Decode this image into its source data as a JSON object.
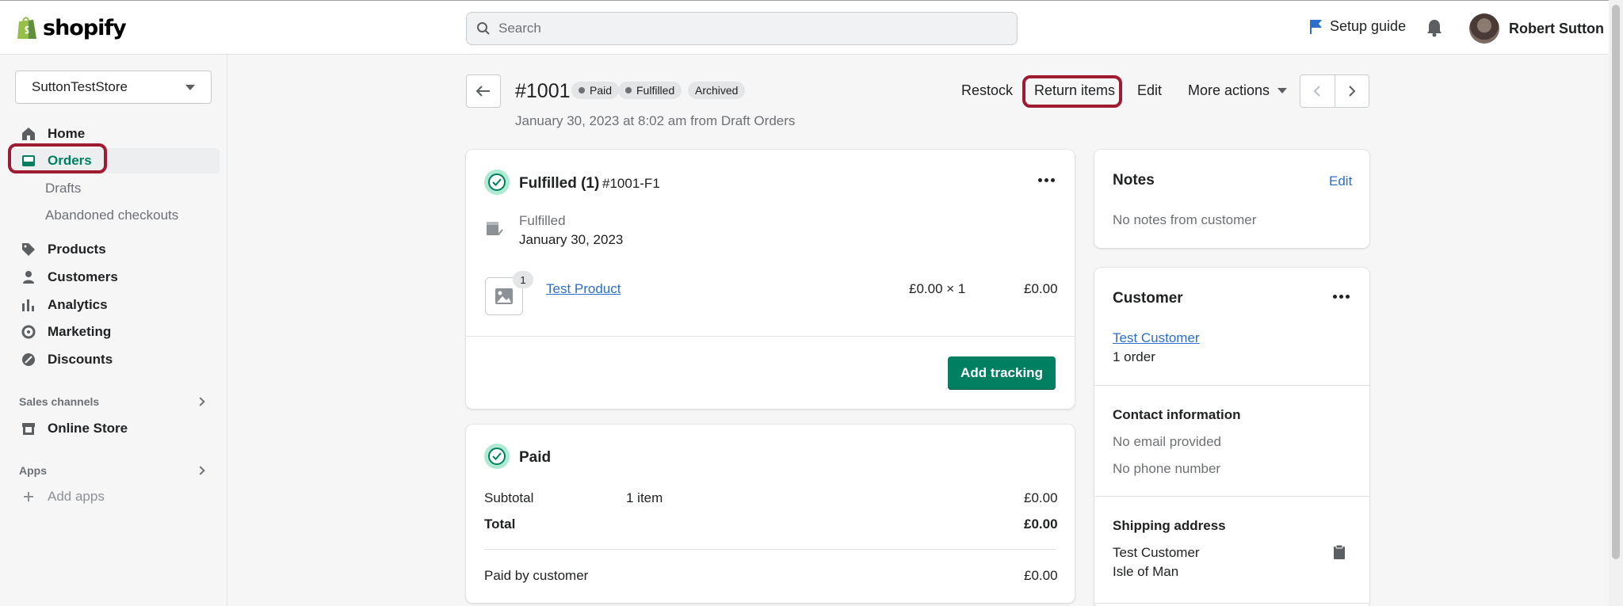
{
  "topbar": {
    "brand": "shopify",
    "search_placeholder": "Search",
    "setup_guide": "Setup guide",
    "user_name": "Robert Sutton"
  },
  "sidebar": {
    "store_name": "SuttonTestStore",
    "items": [
      {
        "label": "Home",
        "icon": "home-icon"
      },
      {
        "label": "Orders",
        "icon": "inbox-icon"
      },
      {
        "label": "Products",
        "icon": "tag-icon"
      },
      {
        "label": "Customers",
        "icon": "person-icon"
      },
      {
        "label": "Analytics",
        "icon": "bar-chart-icon"
      },
      {
        "label": "Marketing",
        "icon": "target-icon"
      },
      {
        "label": "Discounts",
        "icon": "discount-icon"
      }
    ],
    "orders_sub": [
      "Drafts",
      "Abandoned checkouts"
    ],
    "sales_channels_label": "Sales channels",
    "online_store": "Online Store",
    "apps_label": "Apps",
    "add_apps": "Add apps"
  },
  "order": {
    "title": "#1001",
    "badges": [
      "Paid",
      "Fulfilled",
      "Archived"
    ],
    "subtitle": "January 30, 2023 at 8:02 am from Draft Orders",
    "actions": {
      "restock": "Restock",
      "return_items": "Return items",
      "edit": "Edit",
      "more_actions": "More actions"
    }
  },
  "fulfilled_card": {
    "title": "Fulfilled (1)",
    "code": "#1001-F1",
    "status_label": "Fulfilled",
    "status_date": "January 30, 2023",
    "line_item": {
      "qty_badge": "1",
      "name": "Test Product",
      "unit": "£0.00 × 1",
      "total": "£0.00"
    },
    "add_tracking": "Add tracking"
  },
  "paid_card": {
    "title": "Paid",
    "subtotal_label": "Subtotal",
    "subtotal_items": "1 item",
    "subtotal_value": "£0.00",
    "total_label": "Total",
    "total_value": "£0.00",
    "paid_by_label": "Paid by customer",
    "paid_by_value": "£0.00"
  },
  "notes_card": {
    "title": "Notes",
    "edit": "Edit",
    "body": "No notes from customer"
  },
  "customer_card": {
    "title": "Customer",
    "name": "Test Customer",
    "orders": "1 order",
    "contact_title": "Contact information",
    "email": "No email provided",
    "phone": "No phone number",
    "shipping_title": "Shipping address",
    "ship_name": "Test Customer",
    "ship_region": "Isle of Man"
  },
  "colors": {
    "accent_green": "#008060",
    "highlight_red": "#9e1b32",
    "link_blue": "#2c6ecb"
  }
}
